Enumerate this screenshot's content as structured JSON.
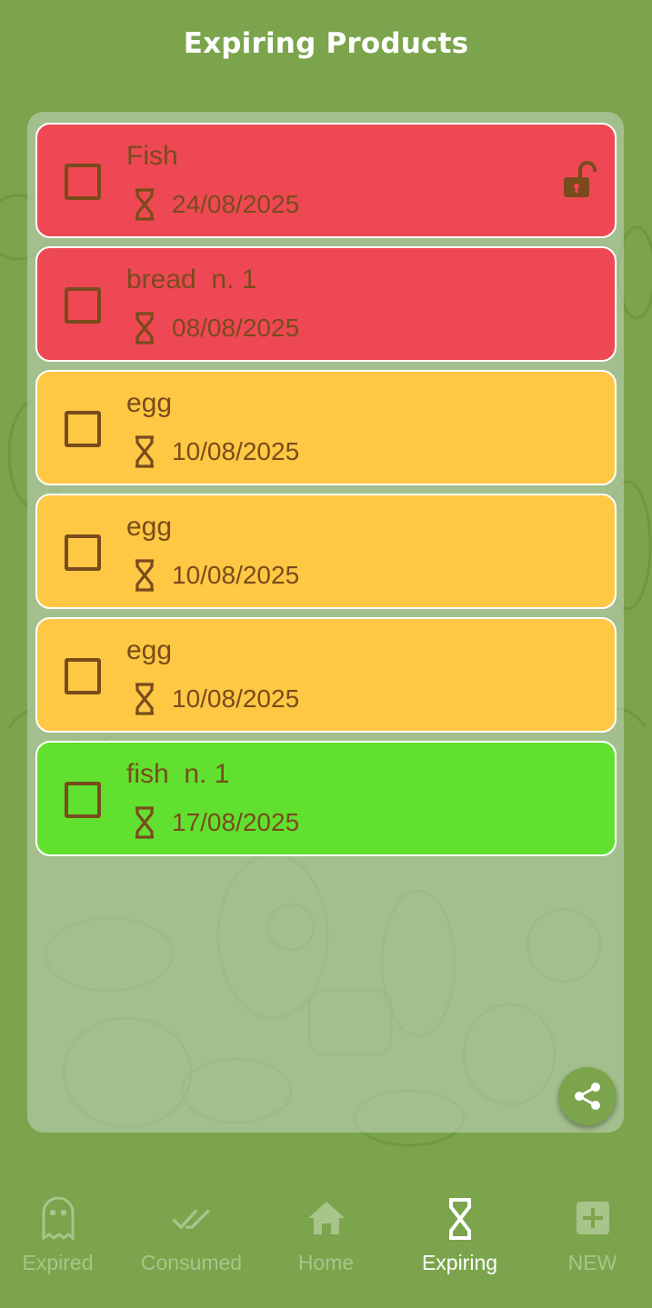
{
  "header": {
    "title": "Expiring Products"
  },
  "colors": {
    "background": "#7ba44c",
    "expired_red": "#ee4854",
    "warning_yellow": "#fec844",
    "fresh_green": "#61e02f",
    "text_brown": "#7a4b1c"
  },
  "items": [
    {
      "name": "Fish",
      "date": "24/08/2025",
      "color": "#ee4854",
      "icon": "hourglass-icon",
      "lock": "unlock-icon"
    },
    {
      "name": "bread  n. 1",
      "date": "08/08/2025",
      "color": "#ee4854",
      "icon": "hourglass-icon"
    },
    {
      "name": "egg",
      "date": "10/08/2025",
      "color": "#fec844",
      "icon": "hourglass-icon"
    },
    {
      "name": "egg",
      "date": "10/08/2025",
      "color": "#fec844",
      "icon": "hourglass-icon"
    },
    {
      "name": "egg",
      "date": "10/08/2025",
      "color": "#fec844",
      "icon": "hourglass-icon"
    },
    {
      "name": "fish  n. 1",
      "date": "17/08/2025",
      "color": "#61e02f",
      "icon": "hourglass-icon"
    }
  ],
  "fab": {
    "icon": "share-icon"
  },
  "nav": {
    "items": [
      {
        "label": "Expired",
        "icon": "ghost-icon",
        "active": false
      },
      {
        "label": "Consumed",
        "icon": "double-check-icon",
        "active": false
      },
      {
        "label": "Home",
        "icon": "home-icon",
        "active": false
      },
      {
        "label": "Expiring",
        "icon": "hourglass-icon",
        "active": true
      },
      {
        "label": "NEW",
        "icon": "add-box-icon",
        "active": false
      }
    ]
  }
}
